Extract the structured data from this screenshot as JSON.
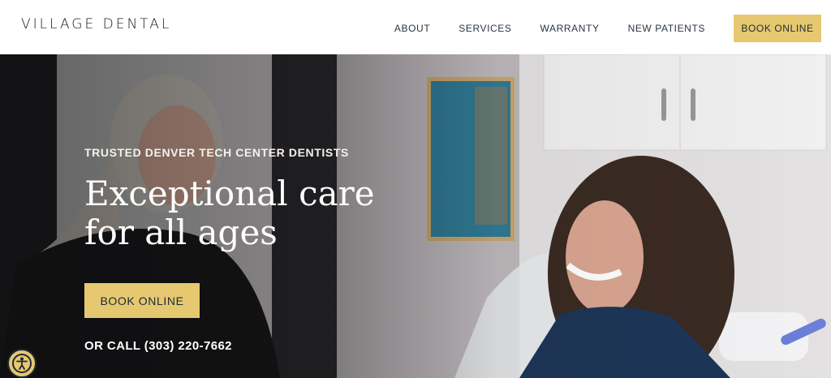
{
  "brand": {
    "logo_text": "VILLAGE DENTAL"
  },
  "nav": {
    "items": [
      {
        "label": "ABOUT"
      },
      {
        "label": "SERVICES"
      },
      {
        "label": "WARRANTY"
      },
      {
        "label": "NEW PATIENTS"
      }
    ],
    "book_label": "BOOK ONLINE"
  },
  "hero": {
    "eyebrow": "TRUSTED DENVER TECH CENTER DENTISTS",
    "headline_line1": "Exceptional care",
    "headline_line2": "for all ages",
    "book_label": "BOOK ONLINE",
    "call_text": "OR CALL (303) 220-7662"
  },
  "accessibility": {
    "icon": "accessibility-icon"
  },
  "colors": {
    "accent": "#e6c871",
    "nav_text": "#2a3440",
    "hero_text": "#ffffff"
  }
}
